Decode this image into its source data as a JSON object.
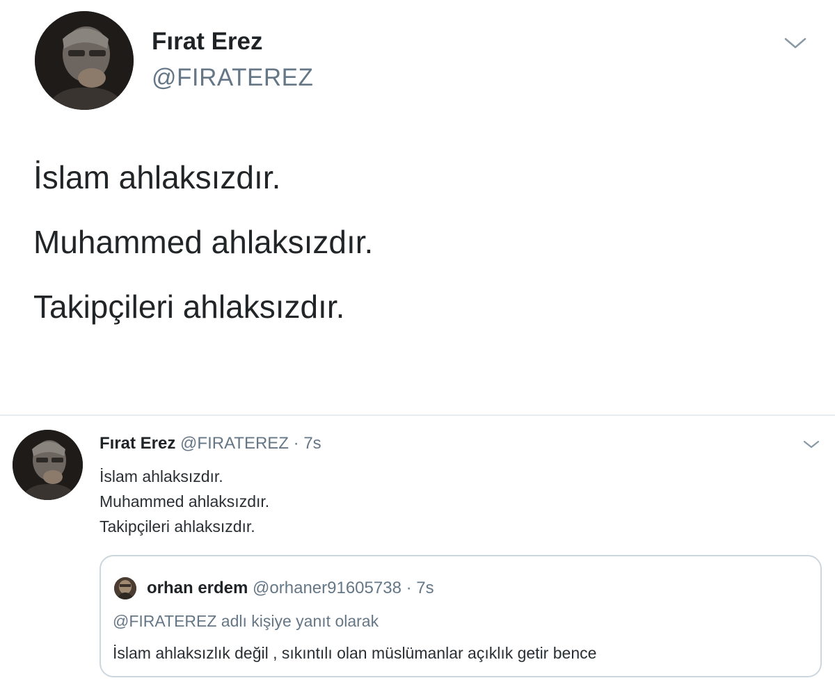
{
  "main_tweet": {
    "author_name": "Fırat Erez",
    "author_handle": "@FIRATEREZ",
    "menu_icon": "chevron-down-icon",
    "lines": [
      "İslam ahlaksızdır.",
      "Muhammed ahlaksızdır.",
      "Takipçileri ahlaksızdır."
    ]
  },
  "feed_tweet": {
    "author_name": "Fırat Erez",
    "author_handle": "@FIRATEREZ",
    "separator": "·",
    "time": "7s",
    "menu_icon": "chevron-down-icon",
    "lines": [
      "İslam ahlaksızdır.",
      "Muhammed ahlaksızdır.",
      "Takipçileri ahlaksızdır."
    ],
    "quoted": {
      "author_name": "orhan erdem",
      "author_handle": "@orhaner91605738",
      "separator": "·",
      "time": "7s",
      "reply_context": "@FIRATEREZ adlı kişiye yanıt olarak",
      "text": "İslam ahlaksızlık değil , sıkıntılı olan müslümanlar açıklık getir bence"
    }
  },
  "colors": {
    "text_primary": "#14171a",
    "text_secondary": "#657786",
    "border": "#ccd6dd",
    "divider": "#e6ecf0"
  }
}
